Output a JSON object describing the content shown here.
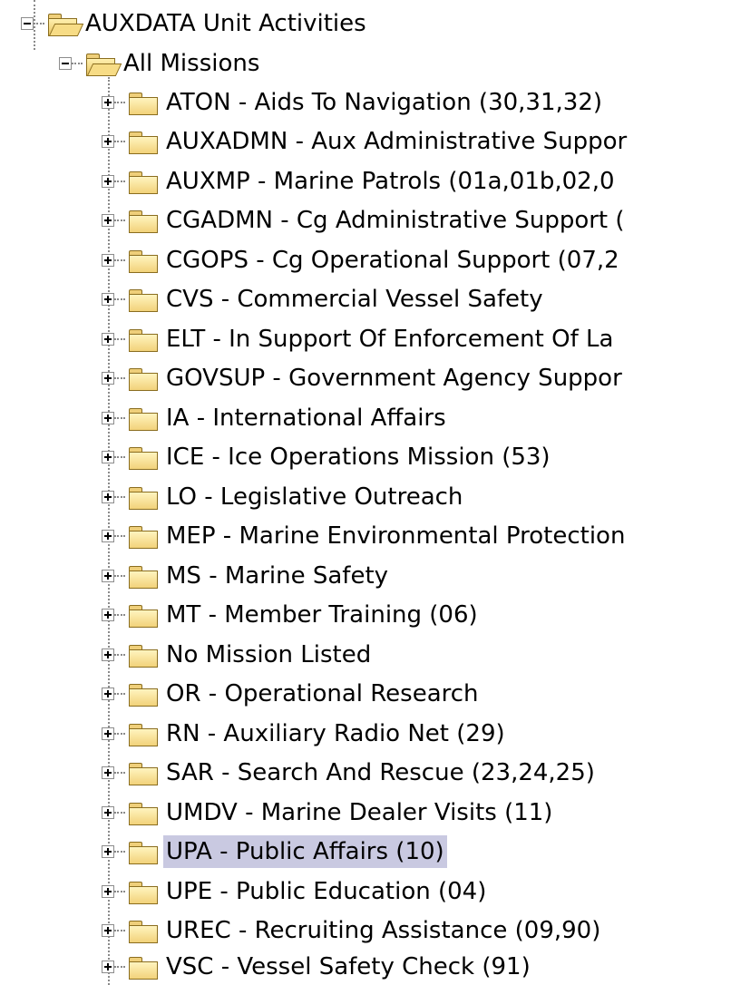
{
  "tree": {
    "root": {
      "label": "AUXDATA Unit Activities",
      "expanded": true,
      "icon": "folder-open-icon"
    },
    "all_missions": {
      "label": "All Missions",
      "expanded": true,
      "icon": "folder-open-icon"
    },
    "selected_label": "UPA - Public Affairs (10)",
    "missions": [
      {
        "label": "ATON - Aids To Navigation (30,31,32)"
      },
      {
        "label": "AUXADMN - Aux Administrative Suppor"
      },
      {
        "label": "AUXMP - Marine Patrols (01a,01b,02,0"
      },
      {
        "label": "CGADMN - Cg Administrative Support ("
      },
      {
        "label": "CGOPS - Cg Operational Support (07,2"
      },
      {
        "label": "CVS - Commercial Vessel Safety"
      },
      {
        "label": "ELT - In Support Of Enforcement Of La"
      },
      {
        "label": "GOVSUP - Government Agency Suppor"
      },
      {
        "label": "IA - International Affairs"
      },
      {
        "label": "ICE - Ice Operations Mission (53)"
      },
      {
        "label": "LO - Legislative Outreach"
      },
      {
        "label": "MEP - Marine Environmental Protection"
      },
      {
        "label": "MS - Marine Safety"
      },
      {
        "label": "MT - Member Training (06)"
      },
      {
        "label": "No Mission Listed"
      },
      {
        "label": "OR - Operational Research"
      },
      {
        "label": "RN - Auxiliary Radio Net (29)"
      },
      {
        "label": "SAR - Search And Rescue (23,24,25)"
      },
      {
        "label": "UMDV - Marine Dealer Visits (11)"
      },
      {
        "label": "UPA - Public Affairs (10)",
        "selected": true
      },
      {
        "label": "UPE - Public Education (04)"
      },
      {
        "label": "UREC - Recruiting Assistance (09,90)"
      },
      {
        "label": "VSC - Vessel Safety Check (91)"
      }
    ]
  },
  "colors": {
    "window_background": "#0000ee",
    "tree_background": "#ffffff",
    "selection": "#c9c9e1",
    "folder": "#f2d27a"
  }
}
